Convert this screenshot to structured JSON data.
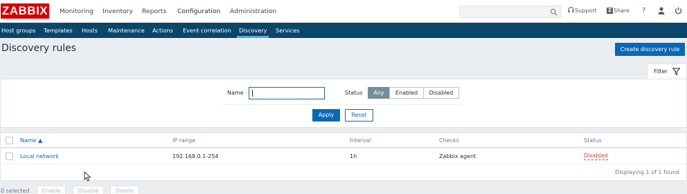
{
  "header": {
    "logo": "ZABBIX",
    "menu": [
      "Monitoring",
      "Inventory",
      "Reports",
      "Configuration",
      "Administration"
    ],
    "search_placeholder": "",
    "support_label": "Support",
    "share_label": "Share",
    "help_label": "?"
  },
  "submenu": [
    "Host groups",
    "Templates",
    "Hosts",
    "Maintenance",
    "Actions",
    "Event correlation",
    "Discovery",
    "Services"
  ],
  "page": {
    "title": "Discovery rules",
    "create_button": "Create discovery rule"
  },
  "filter": {
    "tab_label": "Filter",
    "name_label": "Name",
    "name_value": "",
    "status_label": "Status",
    "status_options": [
      "Any",
      "Enabled",
      "Disabled"
    ],
    "status_selected": "Any",
    "apply_label": "Apply",
    "reset_label": "Reset"
  },
  "table": {
    "headers": {
      "name": "Name ▲",
      "ip_range": "IP range",
      "interval": "Interval",
      "checks": "Checks",
      "status": "Status"
    },
    "rows": [
      {
        "name": "Local network",
        "ip_range": "192.168.0.1-254",
        "interval": "1h",
        "checks": "Zabbix agent",
        "status": "Disabled"
      }
    ],
    "footer": "Displaying 1 of 1 found"
  },
  "actions": {
    "selected": "0 selected",
    "enable": "Enable",
    "disable": "Disable",
    "delete": "Delete"
  },
  "colors": {
    "brand": "#d40000",
    "nav": "#0a466a",
    "primary": "#0a69b4",
    "disabled_status": "#e33734"
  }
}
